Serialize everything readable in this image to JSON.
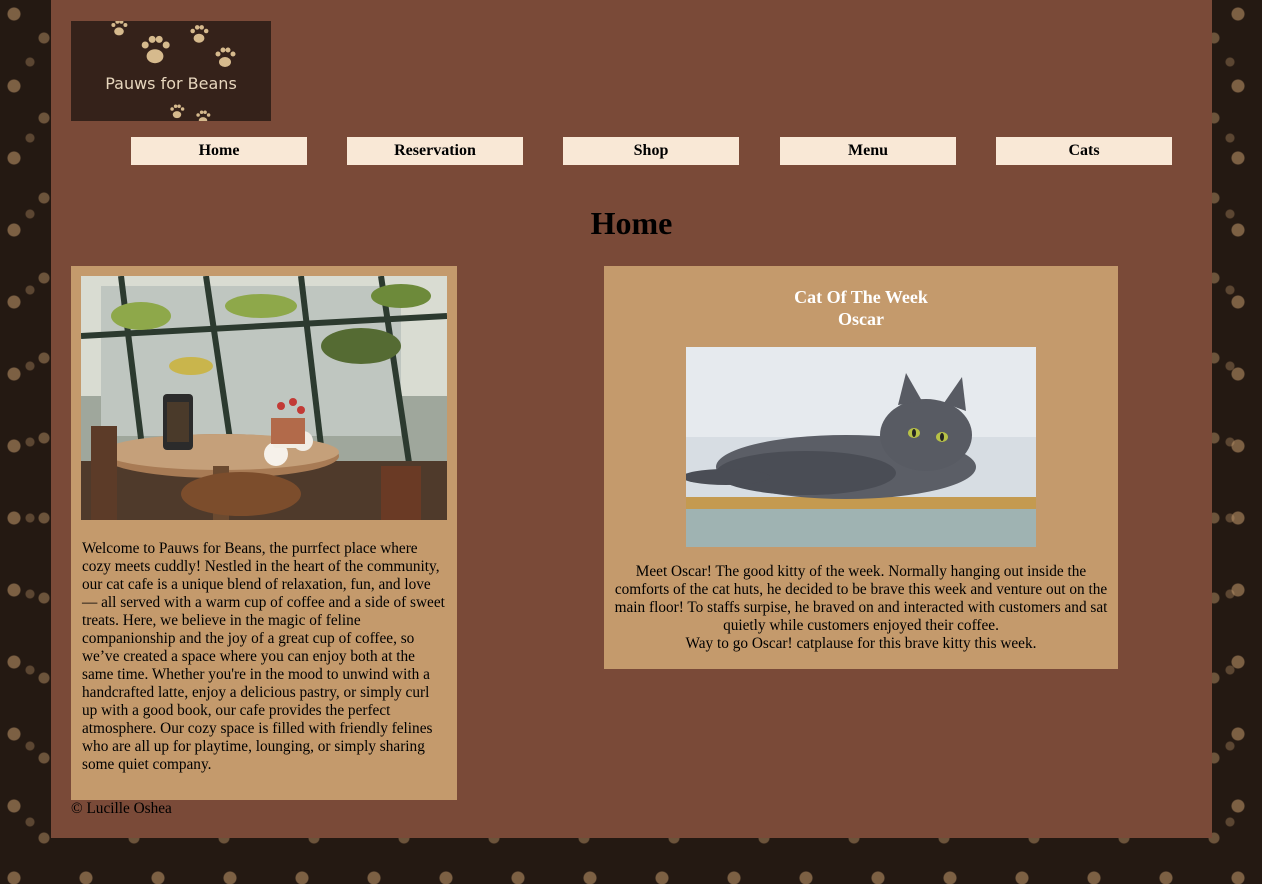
{
  "logo": {
    "text": "Pauws for Beans",
    "icon": "paw-print-icon"
  },
  "nav": {
    "items": [
      {
        "label": "Home"
      },
      {
        "label": "Reservation"
      },
      {
        "label": "Shop"
      },
      {
        "label": "Menu"
      },
      {
        "label": "Cats"
      }
    ]
  },
  "main": {
    "title": "Home",
    "welcome": {
      "text": "Welcome to Pauws for Beans, the purrfect place where cozy meets cuddly! Nestled in the heart of the community, our cat cafe is a unique blend of relaxation, fun, and love — all served with a warm cup of coffee and a side of sweet treats. Here, we believe in the magic of feline companionship and the joy of a great cup of coffee, so we’ve created a space where you can enjoy both at the same time. Whether you're in the mood to unwind with a handcrafted latte, enjoy a delicious pastry, or simply curl up with a good book, our cafe provides the perfect atmosphere. Our cozy space is filled with friendly felines who are all up for playtime, lounging, or simply sharing some quiet company."
    },
    "cat_of_week": {
      "heading": "Cat Of The Week",
      "name": "Oscar",
      "description": "Meet Oscar! The good kitty of the week. Normally hanging out inside the comforts of the cat huts, he decided to be brave this week and venture out on the main floor! To staffs surpise, he braved on and interacted with customers and sat quietly while customers enjoyed their coffee.",
      "closing": "Way to go Oscar! catplause for this brave kitty this week."
    }
  },
  "footer": {
    "text": "© Lucille Oshea"
  },
  "colors": {
    "page_background": "#7a4a38",
    "card_background": "#c49a6c",
    "nav_button": "#f9e8d6",
    "logo_background": "#35221a"
  }
}
